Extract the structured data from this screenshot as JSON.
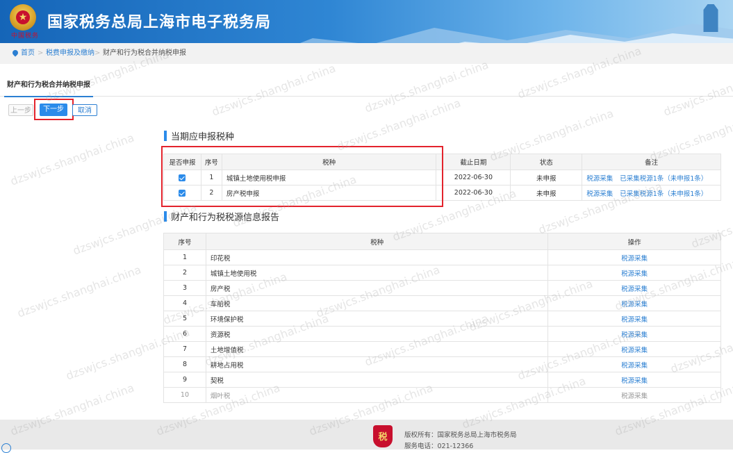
{
  "header": {
    "title": "国家税务总局上海市电子税务局",
    "seal_text": "中国税务"
  },
  "breadcrumb": {
    "home": "首页",
    "level2": "税费申报及缴纳",
    "current": "财产和行为税合并纳税申报",
    "separator": ">"
  },
  "tab": {
    "label": "财产和行为税合并纳税申报"
  },
  "buttons": {
    "prev": "上一步",
    "next": "下一步",
    "cancel": "取消"
  },
  "section1": {
    "title": "当期应申报税种",
    "headers": [
      "是否申报",
      "序号",
      "税种",
      "截止日期",
      "状态",
      "备注"
    ],
    "rows": [
      {
        "checked": true,
        "no": "1",
        "tax": "城镇土地使用税申报",
        "deadline": "2022-06-30",
        "status": "未申报",
        "note_link1": "税源采集",
        "note_link2": "已采集税源1条（未申报1条）"
      },
      {
        "checked": true,
        "no": "2",
        "tax": "房产税申报",
        "deadline": "2022-06-30",
        "status": "未申报",
        "note_link1": "税源采集",
        "note_link2": "已采集税源1条（未申报1条）"
      }
    ]
  },
  "section2": {
    "title": "财产和行为税税源信息报告",
    "headers": [
      "序号",
      "税种",
      "操作"
    ],
    "rows": [
      {
        "no": "1",
        "tax": "印花税",
        "action": "税源采集",
        "enabled": true
      },
      {
        "no": "2",
        "tax": "城镇土地使用税",
        "action": "税源采集",
        "enabled": true
      },
      {
        "no": "3",
        "tax": "房产税",
        "action": "税源采集",
        "enabled": true
      },
      {
        "no": "4",
        "tax": "车船税",
        "action": "税源采集",
        "enabled": true
      },
      {
        "no": "5",
        "tax": "环境保护税",
        "action": "税源采集",
        "enabled": true
      },
      {
        "no": "6",
        "tax": "资源税",
        "action": "税源采集",
        "enabled": true
      },
      {
        "no": "7",
        "tax": "土地增值税",
        "action": "税源采集",
        "enabled": true
      },
      {
        "no": "8",
        "tax": "耕地占用税",
        "action": "税源采集",
        "enabled": true
      },
      {
        "no": "9",
        "tax": "契税",
        "action": "税源采集",
        "enabled": true
      },
      {
        "no": "10",
        "tax": "烟叶税",
        "action": "税源采集",
        "enabled": false
      }
    ]
  },
  "footer": {
    "copyright": "版权所有：国家税务总局上海市税务局",
    "phone": "服务电话：021-12366"
  },
  "watermark": "dzswjcs.shanghai.china",
  "colors": {
    "accent": "#2b8bea",
    "highlight": "#e3232c",
    "link": "#2b7fd2"
  }
}
